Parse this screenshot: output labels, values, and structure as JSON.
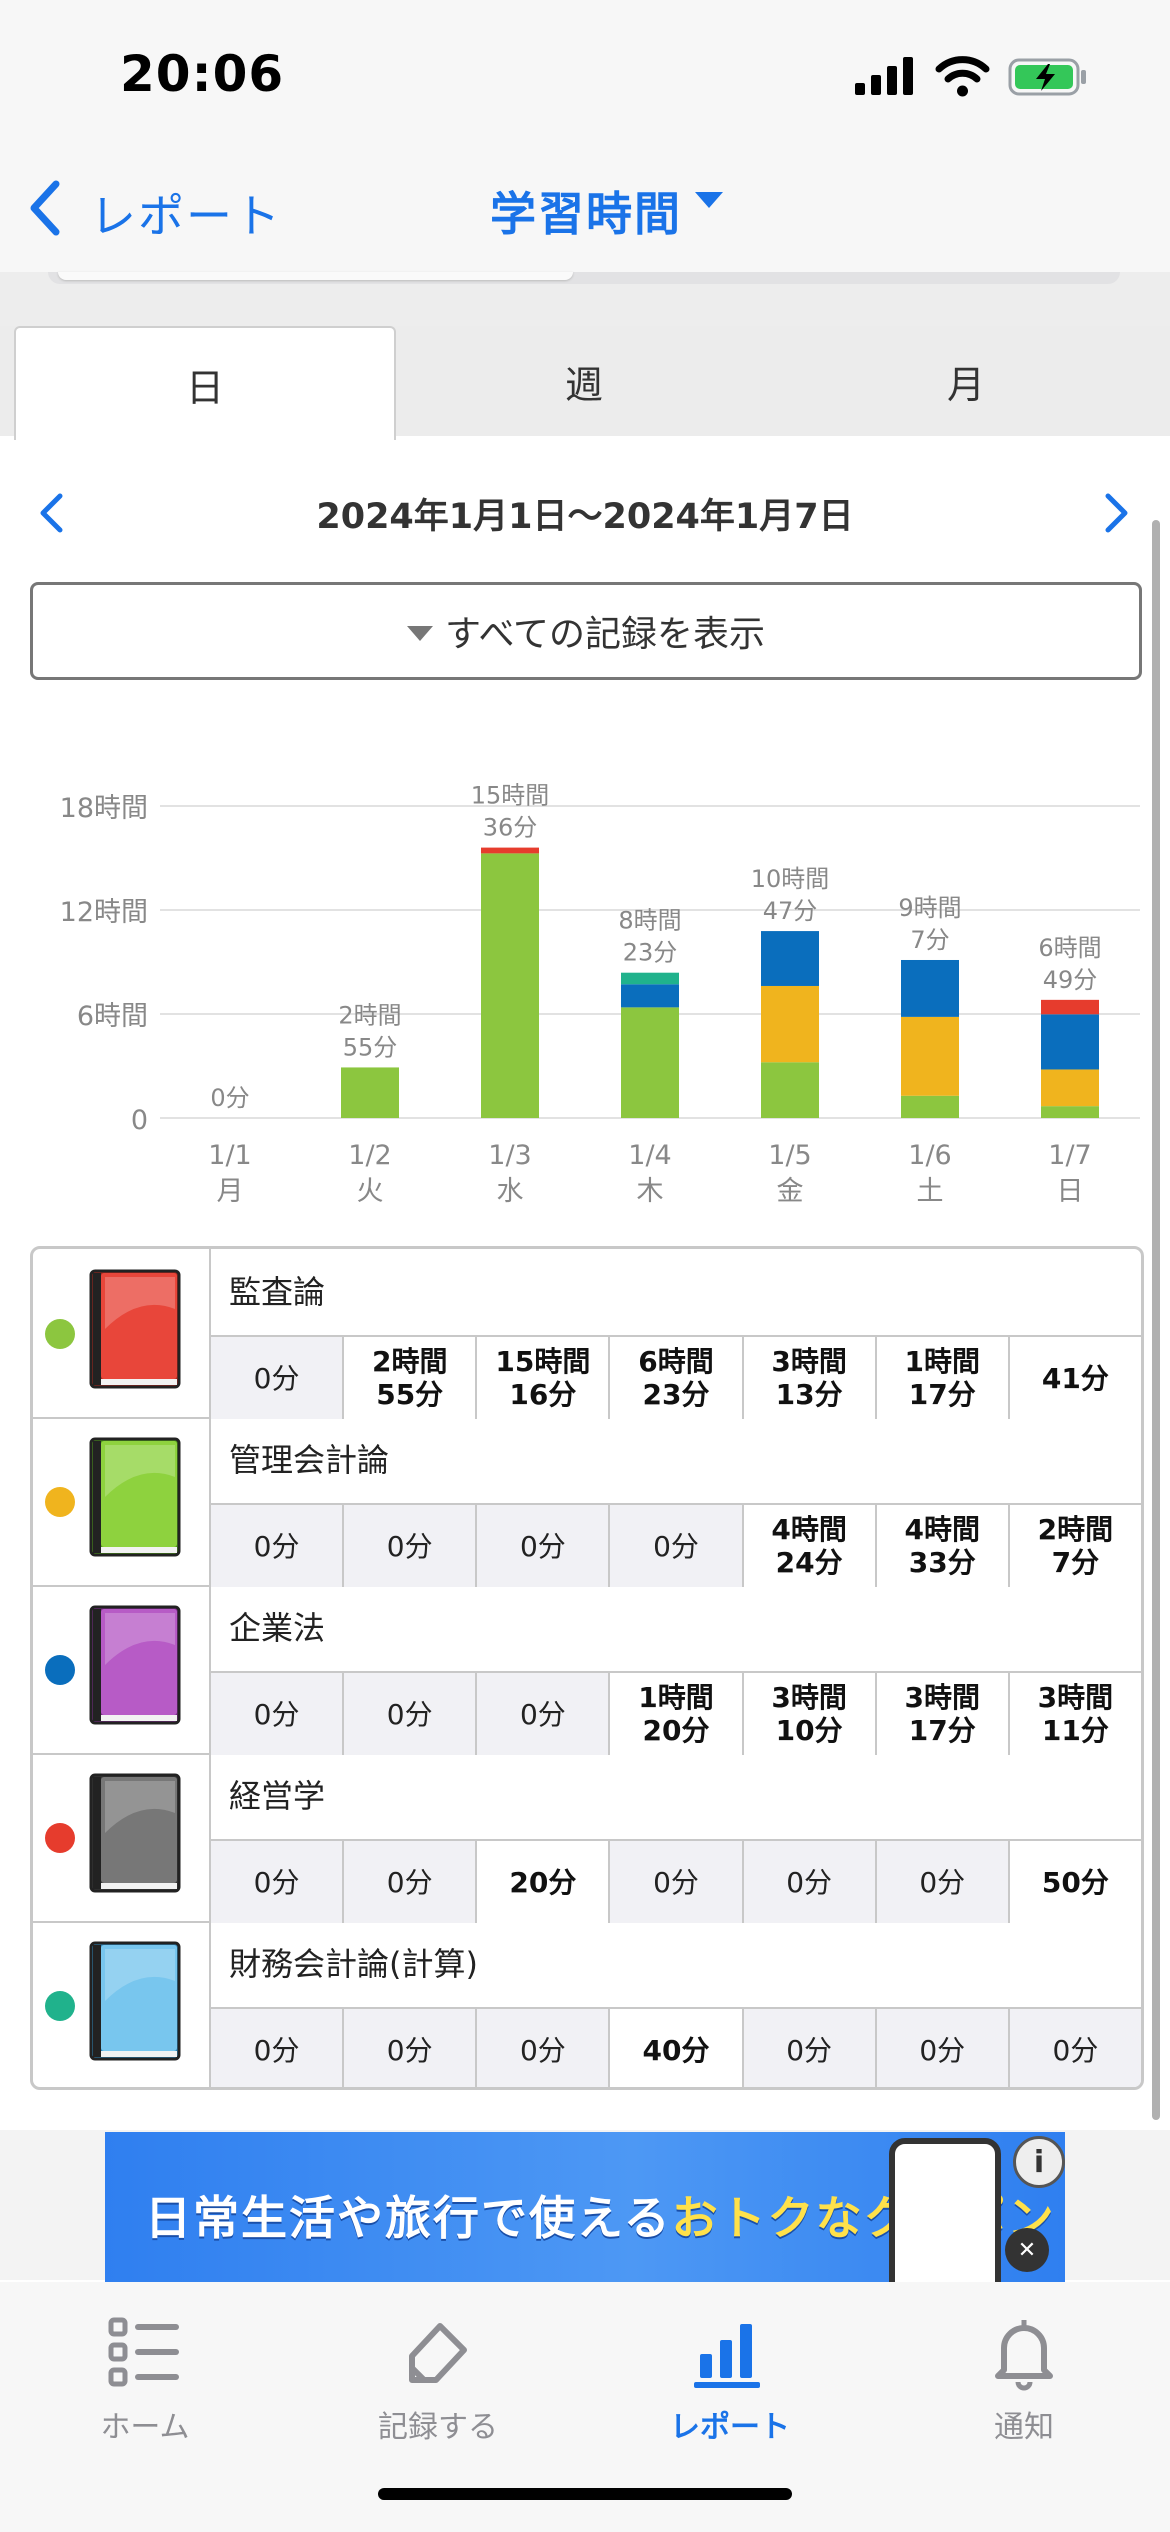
{
  "status_bar": {
    "time": "20:06"
  },
  "nav": {
    "back_label": "レポート",
    "title": "学習時間"
  },
  "tabs": [
    "日",
    "週",
    "月"
  ],
  "active_tab": 0,
  "date_range": "2024年1月1日〜2024年1月7日",
  "show_all_label": "すべての記録を表示",
  "chart_data": {
    "type": "bar",
    "stacked": true,
    "categories": [
      "1/1\n月",
      "1/2\n火",
      "1/3\n水",
      "1/4\n木",
      "1/5\n金",
      "1/6\n土",
      "1/7\n日"
    ],
    "category_dates": [
      "1/1",
      "1/2",
      "1/3",
      "1/4",
      "1/5",
      "1/6",
      "1/7"
    ],
    "category_days": [
      "月",
      "火",
      "水",
      "木",
      "金",
      "土",
      "日"
    ],
    "ytick_labels": [
      "0",
      "6時間",
      "12時間",
      "18時間"
    ],
    "ytick_values": [
      0,
      6,
      12,
      18
    ],
    "ylim": [
      0,
      18
    ],
    "total_labels": [
      "0分",
      "2時間\n55分",
      "15時間\n36分",
      "8時間\n23分",
      "10時間\n47分",
      "9時間\n7分",
      "6時間\n49分"
    ],
    "series": [
      {
        "name": "監査論",
        "color": "#8cc63f",
        "values": [
          0,
          2.917,
          15.267,
          6.383,
          3.217,
          1.283,
          0.683
        ]
      },
      {
        "name": "管理会計論",
        "color": "#f0b41e",
        "values": [
          0,
          0,
          0,
          0,
          4.4,
          4.55,
          2.117
        ]
      },
      {
        "name": "企業法",
        "color": "#0a6ebd",
        "values": [
          0,
          0,
          0,
          1.333,
          3.167,
          3.283,
          3.183
        ]
      },
      {
        "name": "経営学",
        "color": "#e63c2d",
        "values": [
          0,
          0,
          0.333,
          0,
          0,
          0,
          0.833
        ]
      },
      {
        "name": "財務会計論(計算)",
        "color": "#20b28c",
        "values": [
          0,
          0,
          0,
          0.667,
          0,
          0,
          0
        ]
      }
    ],
    "grid": true
  },
  "subjects": [
    {
      "name": "監査論",
      "dot_color": "#8cc63f",
      "book_color": "#e8463a",
      "book_dark": "#a8261c",
      "cells": [
        "0分",
        "2時間\n55分",
        "15時間\n16分",
        "6時間\n23分",
        "3時間\n13分",
        "1時間\n17分",
        "41分"
      ]
    },
    {
      "name": "管理会計論",
      "dot_color": "#f0b41e",
      "book_color": "#8ed23e",
      "book_dark": "#4f9a1a",
      "cells": [
        "0分",
        "0分",
        "0分",
        "0分",
        "4時間\n24分",
        "4時間\n33分",
        "2時間\n7分"
      ]
    },
    {
      "name": "企業法",
      "dot_color": "#0a6ebd",
      "book_color": "#b75bc6",
      "book_dark": "#7a2c88",
      "cells": [
        "0分",
        "0分",
        "0分",
        "1時間\n20分",
        "3時間\n10分",
        "3時間\n17分",
        "3時間\n11分"
      ]
    },
    {
      "name": "経営学",
      "dot_color": "#e63c2d",
      "book_color": "#777777",
      "book_dark": "#3a3a3a",
      "cells": [
        "0分",
        "0分",
        "20分",
        "0分",
        "0分",
        "0分",
        "50分"
      ]
    },
    {
      "name": "財務会計論(計算)",
      "dot_color": "#20b28c",
      "book_color": "#78c6ee",
      "book_dark": "#2f86b8",
      "cells": [
        "0分",
        "0分",
        "0分",
        "40分",
        "0分",
        "0分",
        "0分"
      ]
    }
  ],
  "ad": {
    "text_a": "日常生活や旅行で使える",
    "text_b": "おトクなクーポン"
  },
  "tabbar": [
    {
      "label": "ホーム",
      "icon": "list-icon",
      "active": false
    },
    {
      "label": "記録する",
      "icon": "pencil-icon",
      "active": false
    },
    {
      "label": "レポート",
      "icon": "bar-chart-icon",
      "active": true
    },
    {
      "label": "通知",
      "icon": "bell-icon",
      "active": false
    }
  ]
}
